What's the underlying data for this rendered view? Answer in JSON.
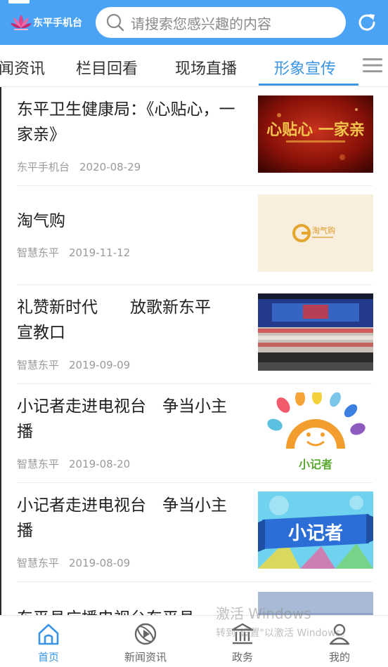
{
  "header": {
    "logo_text": "东平手机台",
    "search_placeholder": "请搜索您感兴趣的内容",
    "accent": "#4aa3f5"
  },
  "tabs": [
    {
      "label": "闻资讯",
      "active": false
    },
    {
      "label": "栏目回看",
      "active": false
    },
    {
      "label": "现场直播",
      "active": false
    },
    {
      "label": "形象宣传",
      "active": true
    }
  ],
  "active_color": "#3a95e6",
  "news": [
    {
      "title": "东平卫生健康局：《心贴心，一家亲》",
      "source": "东平手机台",
      "date": "2020-08-29",
      "thumb": "red-gold-banner",
      "thumb_text": "心贴心 一家亲"
    },
    {
      "title": "淘气购",
      "source": "智慧东平",
      "date": "2019-11-12",
      "thumb": "taoqigou-logo",
      "thumb_text": "淘气购"
    },
    {
      "title": "礼赞新时代　　放歌新东平　宣教口",
      "source": "智慧东平",
      "date": "2019-09-09",
      "thumb": "choir-stage-photo",
      "thumb_text": ""
    },
    {
      "title": "小记者走进电视台　争当小主播",
      "source": "智慧东平",
      "date": "2019-08-20",
      "thumb": "sun-mascot-logo",
      "thumb_text": "小记者"
    },
    {
      "title": "小记者走进电视台　争当小主播",
      "source": "智慧东平",
      "date": "2019-08-09",
      "thumb": "ribbon-banner",
      "thumb_text": "小记者"
    },
    {
      "title": "东平县广播电视台东平县",
      "source": "",
      "date": "",
      "thumb": "partial-photo",
      "thumb_text": ""
    }
  ],
  "bottom_nav": [
    {
      "label": "首页",
      "icon": "home-icon",
      "active": true
    },
    {
      "label": "新闻资讯",
      "icon": "news-icon",
      "active": false
    },
    {
      "label": "政务",
      "icon": "government-icon",
      "active": false
    },
    {
      "label": "我的",
      "icon": "profile-icon",
      "active": false
    }
  ],
  "watermark": {
    "title": "激活 Windows",
    "subtitle": "转到\"设置\"以激活 Windows。"
  }
}
